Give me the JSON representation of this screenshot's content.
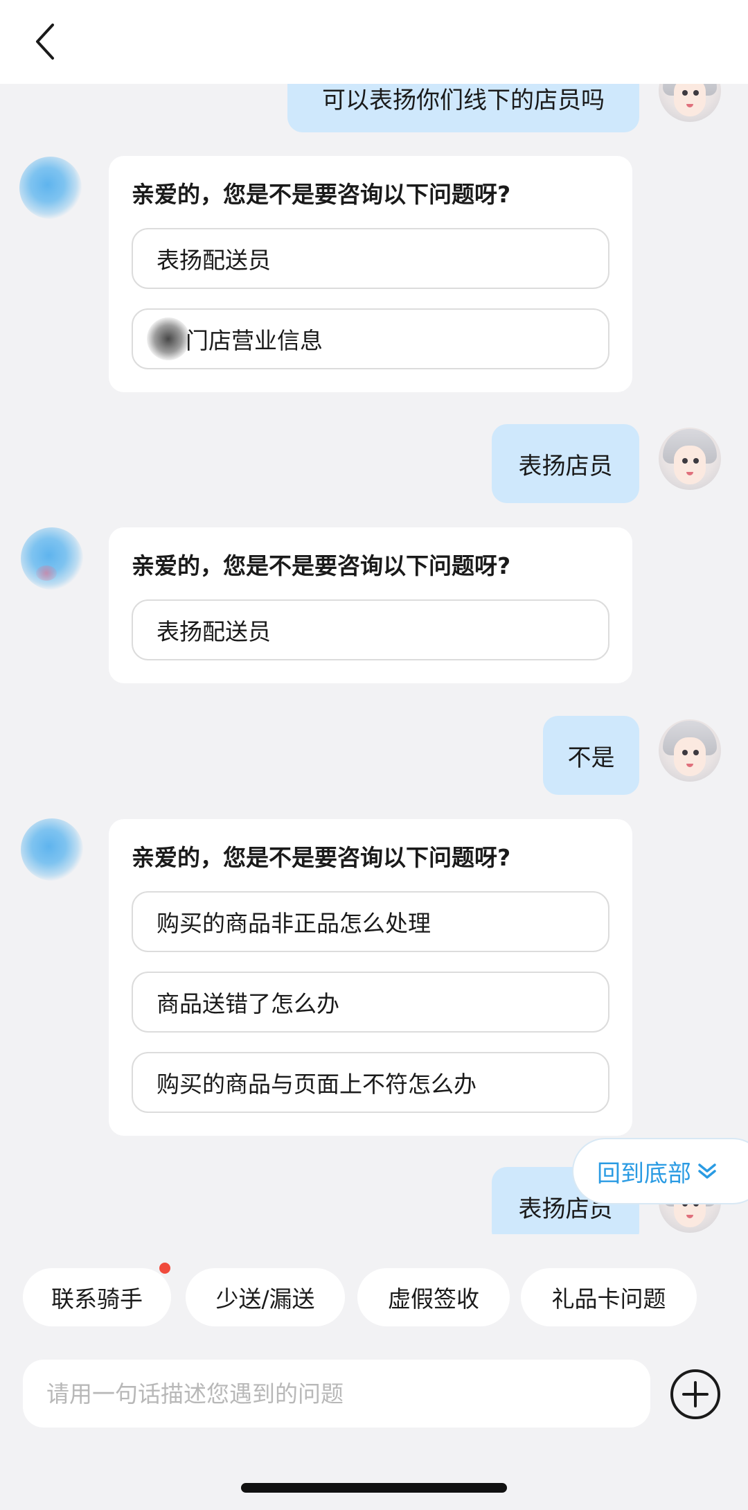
{
  "header": {
    "back_icon": "chevron-left-icon"
  },
  "messages": {
    "user_top": "可以表扬你们线下的店员吗",
    "bot1": {
      "question": "亲爱的，您是不是要咨询以下问题呀?",
      "options": [
        "表扬配送员",
        "门店营业信息"
      ]
    },
    "user1": "表扬店员",
    "bot2": {
      "question": "亲爱的，您是不是要咨询以下问题呀?",
      "options": [
        "表扬配送员"
      ]
    },
    "user2": "不是",
    "bot3": {
      "question": "亲爱的，您是不是要咨询以下问题呀?",
      "options": [
        "购买的商品非正品怎么处理",
        "商品送错了怎么办",
        "购买的商品与页面上不符怎么办"
      ]
    },
    "user3": "表扬店员"
  },
  "scroll_bottom": {
    "label": "回到底部",
    "icon": "double-chevron-down-icon"
  },
  "quick_chips": [
    "联系骑手",
    "少送/漏送",
    "虚假签收",
    "礼品卡问题"
  ],
  "input": {
    "placeholder": "请用一句话描述您遇到的问题",
    "value": ""
  },
  "plus_icon": "plus-circle-icon",
  "colors": {
    "user_bubble": "#cfe8fc",
    "accent": "#2a9be3",
    "badge": "#f04a3c",
    "background": "#f2f2f4"
  }
}
